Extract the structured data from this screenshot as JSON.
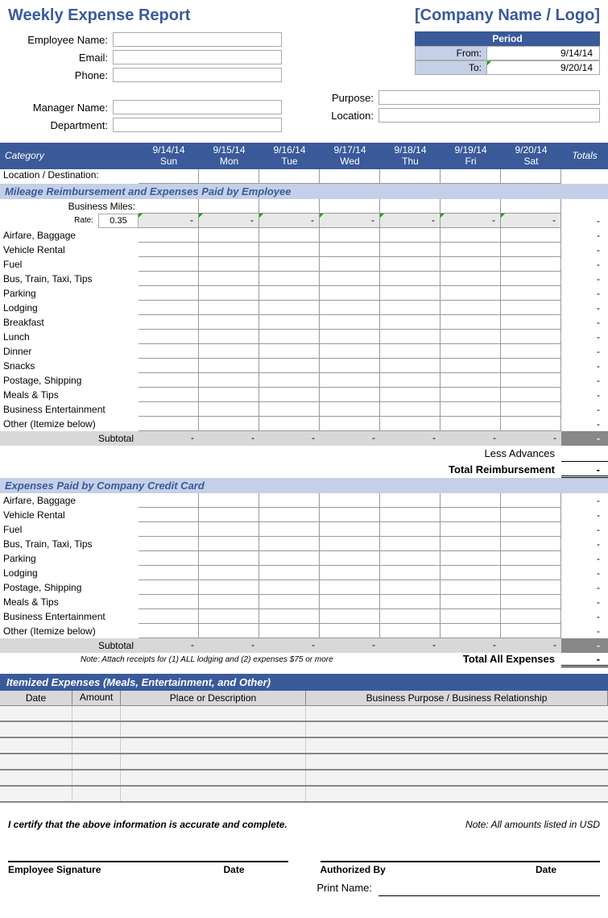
{
  "header": {
    "title": "Weekly Expense Report",
    "company": "[Company Name / Logo]"
  },
  "employee": {
    "name_label": "Employee Name:",
    "email_label": "Email:",
    "phone_label": "Phone:",
    "manager_label": "Manager Name:",
    "dept_label": "Department:",
    "purpose_label": "Purpose:",
    "location_label": "Location:"
  },
  "period": {
    "header": "Period",
    "from_label": "From:",
    "to_label": "To:",
    "from": "9/14/14",
    "to": "9/20/14"
  },
  "grid": {
    "category": "Category",
    "totals": "Totals",
    "days": [
      {
        "date": "9/14/14",
        "dow": "Sun"
      },
      {
        "date": "9/15/14",
        "dow": "Mon"
      },
      {
        "date": "9/16/14",
        "dow": "Tue"
      },
      {
        "date": "9/17/14",
        "dow": "Wed"
      },
      {
        "date": "9/18/14",
        "dow": "Thu"
      },
      {
        "date": "9/19/14",
        "dow": "Fri"
      },
      {
        "date": "9/20/14",
        "dow": "Sat"
      }
    ],
    "location_row": "Location / Destination:"
  },
  "section1": {
    "title": "Mileage Reimbursement and Expenses Paid by Employee",
    "business_miles": "Business Miles:",
    "rate_label": "Rate:",
    "rate_value": "0.35",
    "rows": [
      "Airfare, Baggage",
      "Vehicle Rental",
      "Fuel",
      "Bus, Train, Taxi, Tips",
      "Parking",
      "Lodging",
      "Breakfast",
      "Lunch",
      "Dinner",
      "Snacks",
      "Postage, Shipping",
      "Meals & Tips",
      "Business Entertainment",
      "Other (Itemize below)"
    ],
    "subtotal": "Subtotal",
    "less_advances": "Less Advances",
    "total_reimb": "Total Reimbursement"
  },
  "section2": {
    "title": "Expenses Paid by Company Credit Card",
    "rows": [
      "Airfare, Baggage",
      "Vehicle Rental",
      "Fuel",
      "Bus, Train, Taxi, Tips",
      "Parking",
      "Lodging",
      "Postage, Shipping",
      "Meals & Tips",
      "Business Entertainment",
      "Other (Itemize below)"
    ],
    "subtotal": "Subtotal",
    "note": "Note:   Attach receipts for (1) ALL lodging and (2) expenses $75 or more",
    "total_all": "Total All Expenses"
  },
  "itemized": {
    "title": "Itemized Expenses (Meals, Entertainment, and Other)",
    "cols": {
      "date": "Date",
      "amount": "Amount",
      "place": "Place or Description",
      "purpose": "Business Purpose / Business Relationship"
    }
  },
  "footer": {
    "certify": "I certify that the above information is accurate and complete.",
    "usd_note": "Note: All amounts listed in USD",
    "emp_sig": "Employee Signature",
    "auth_by": "Authorized By",
    "date": "Date",
    "print_name": "Print Name:"
  },
  "dash": "-"
}
